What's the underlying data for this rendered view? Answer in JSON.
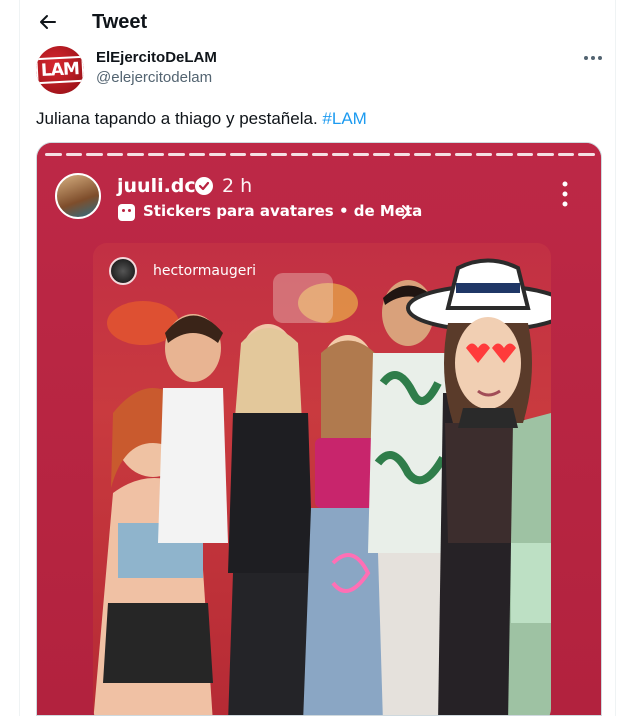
{
  "header": {
    "title": "Tweet",
    "back_icon": "arrow-left-icon"
  },
  "author": {
    "display_name": "ElEjercitoDeLAM",
    "handle": "@elejercitodelam",
    "avatar_logo": "LAM"
  },
  "tweet": {
    "text": "Juliana tapando a thiago y pestañela.",
    "hashtag": "#LAM"
  },
  "story": {
    "username": "juuli.dc",
    "time": "2 h",
    "sticker_label": "Stickers para avatares • de Meta",
    "photo_username": "hectormaugeri"
  },
  "colors": {
    "accent": "#1d9bf0",
    "story_bg": "#b8213f",
    "text": "#0f1419",
    "muted": "#536471"
  }
}
